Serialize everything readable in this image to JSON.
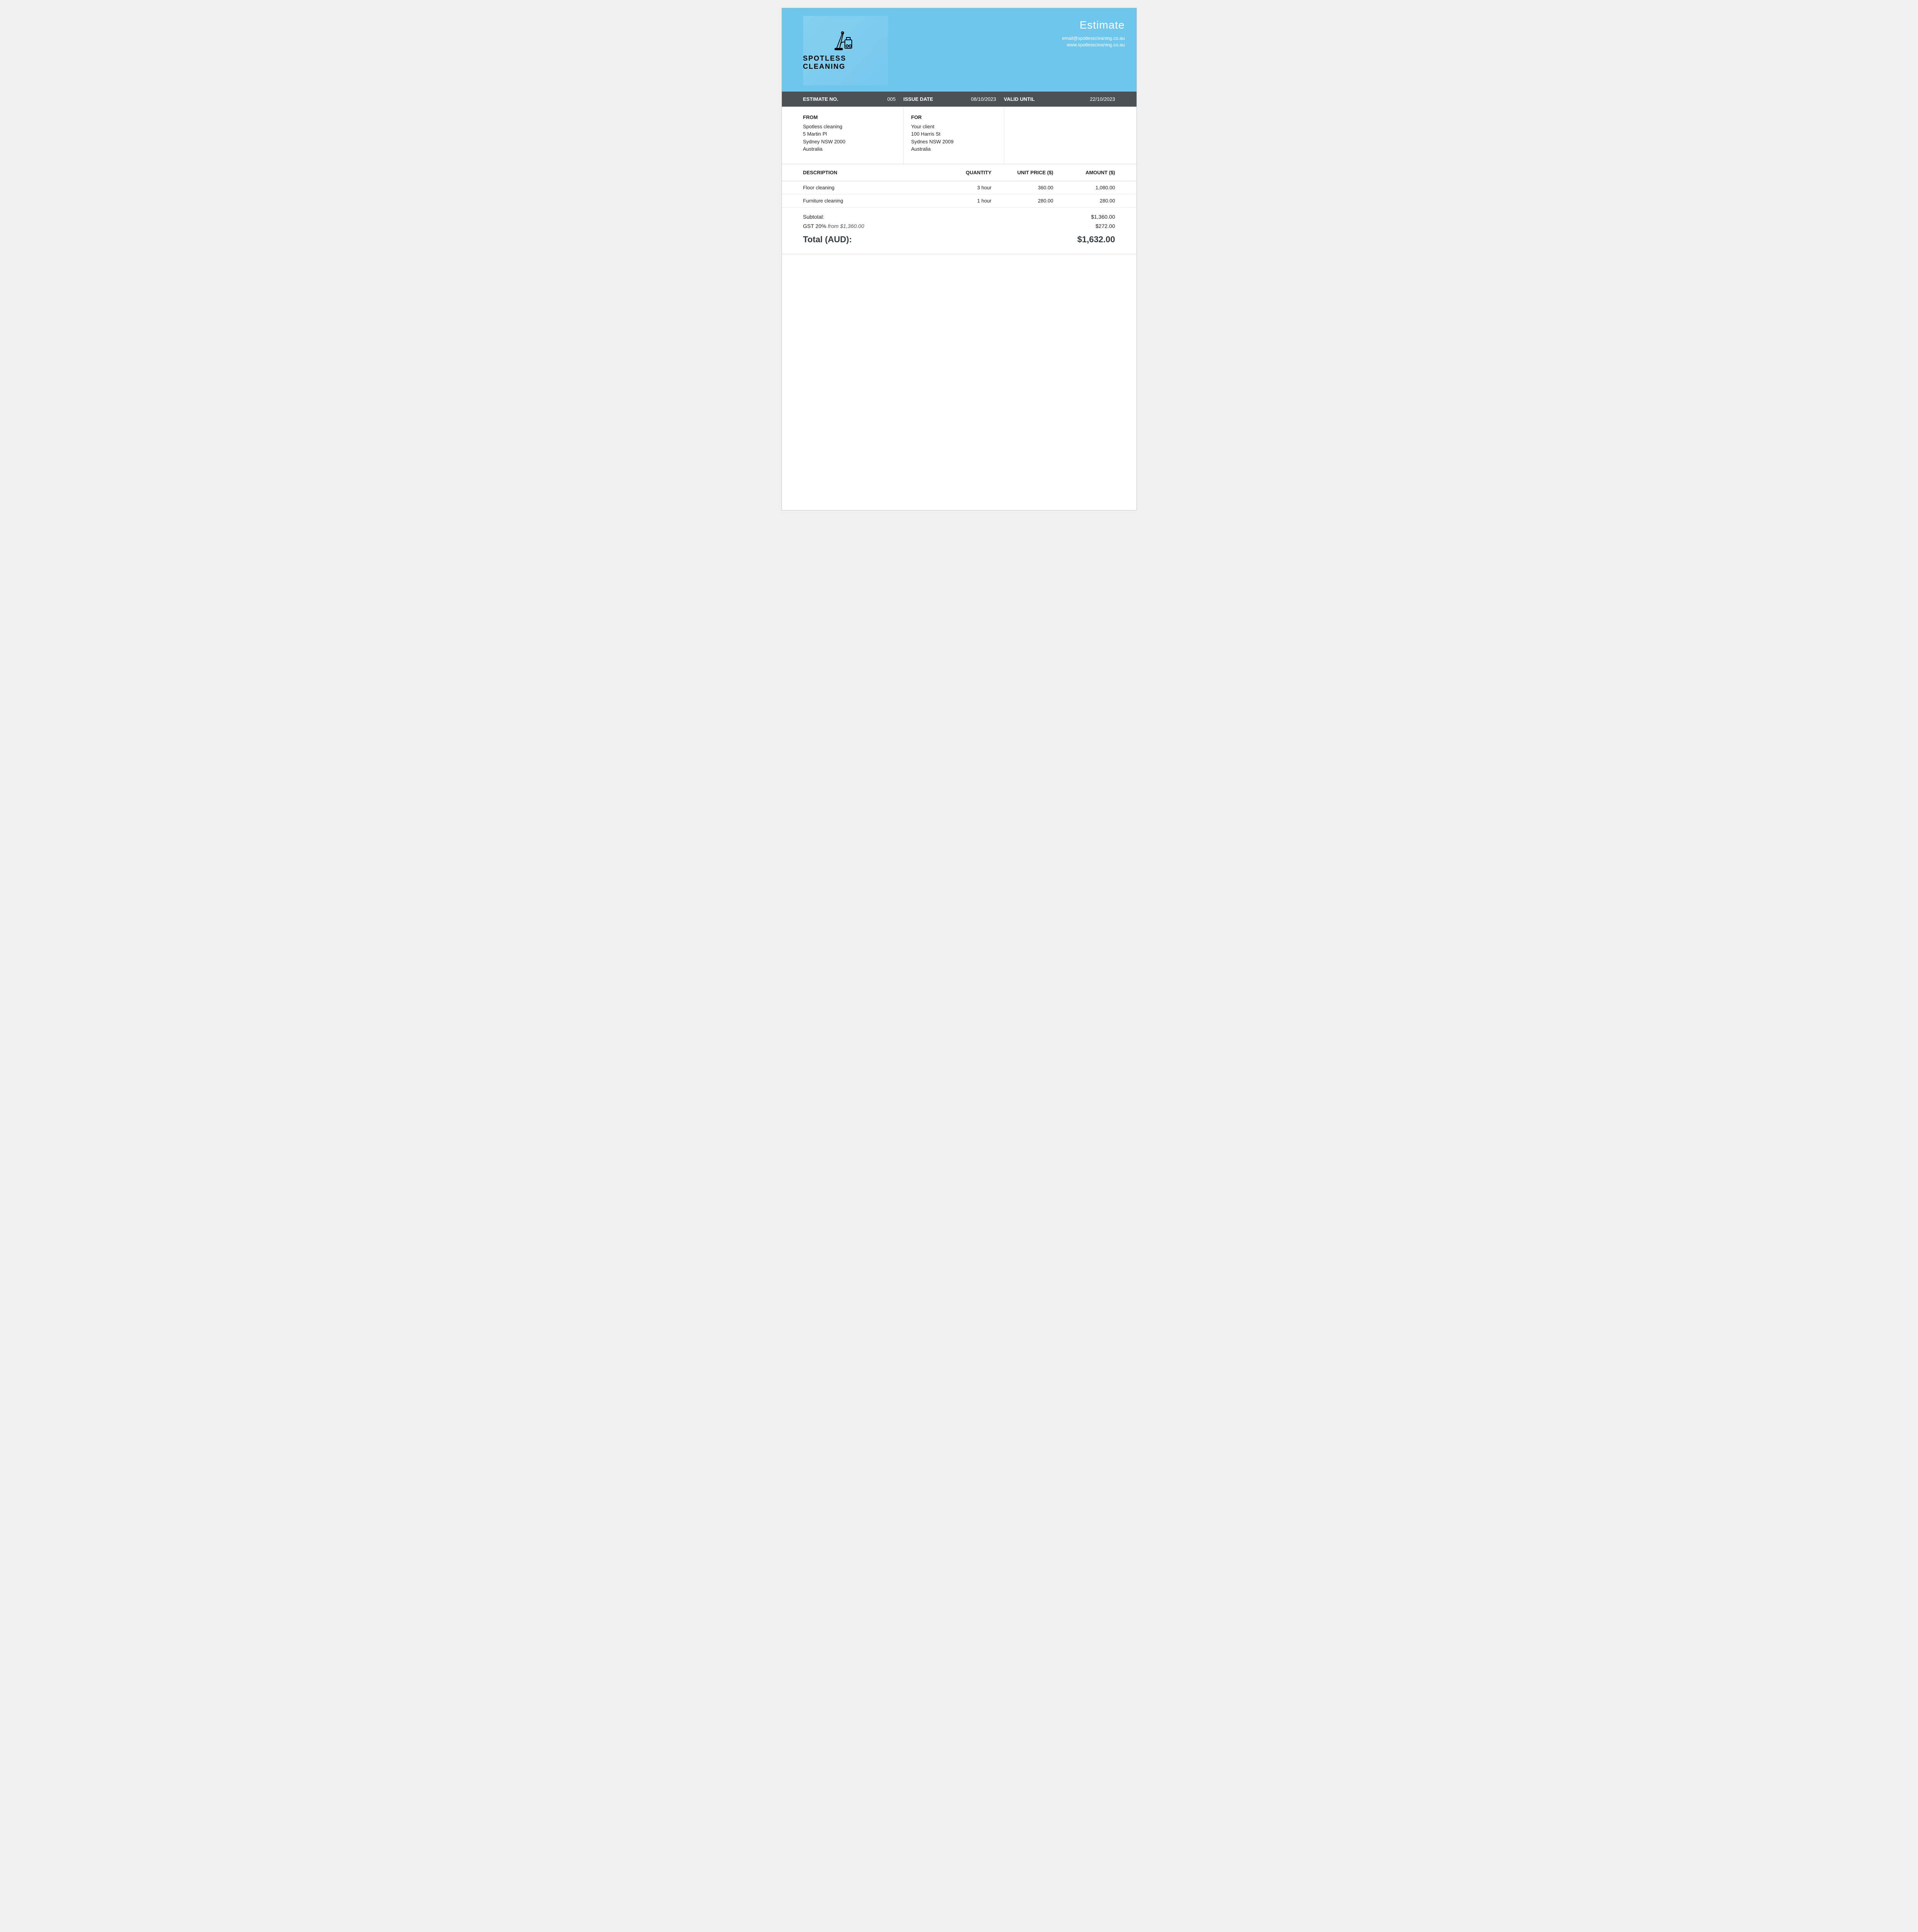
{
  "header": {
    "title": "Estimate",
    "company_name": "SPOTLESS CLEANING",
    "email": "email@spotlesscleaning.co.au",
    "website": "www.spotlesscleaning.co.au"
  },
  "meta": {
    "estimate_no_label": "ESTIMATE NO.",
    "estimate_no_value": "005",
    "issue_date_label": "ISSUE DATE",
    "issue_date_value": "08/10/2023",
    "valid_until_label": "VALID UNTIL",
    "valid_until_value": "22/10/2023"
  },
  "from": {
    "heading": "FROM",
    "name": "Spotless cleaning",
    "street": "5 Martin Pl",
    "city": "Sydney NSW 2000",
    "country": "Australia"
  },
  "for": {
    "heading": "FOR",
    "name": "Your client",
    "street": "100 Harris St",
    "city": "Sydnes NSW 2009",
    "country": "Australia"
  },
  "columns": {
    "description": "DESCRIPTION",
    "quantity": "QUANTITY",
    "unit_price": "UNIT PRICE ($)",
    "amount": "AMOUNT ($)"
  },
  "items": [
    {
      "description": "Floor cleaning",
      "quantity": "3 hour",
      "unit_price": "360.00",
      "amount": "1,080.00"
    },
    {
      "description": "Furniture cleaning",
      "quantity": "1 hour",
      "unit_price": "280.00",
      "amount": "280.00"
    }
  ],
  "totals": {
    "subtotal_label": "Subtotal:",
    "subtotal_value": "$1,360.00",
    "tax_label": "GST 20%",
    "tax_detail": "from $1,360.00",
    "tax_value": "$272.00",
    "grand_label": "Total (AUD):",
    "grand_value": "$1,632.00"
  }
}
